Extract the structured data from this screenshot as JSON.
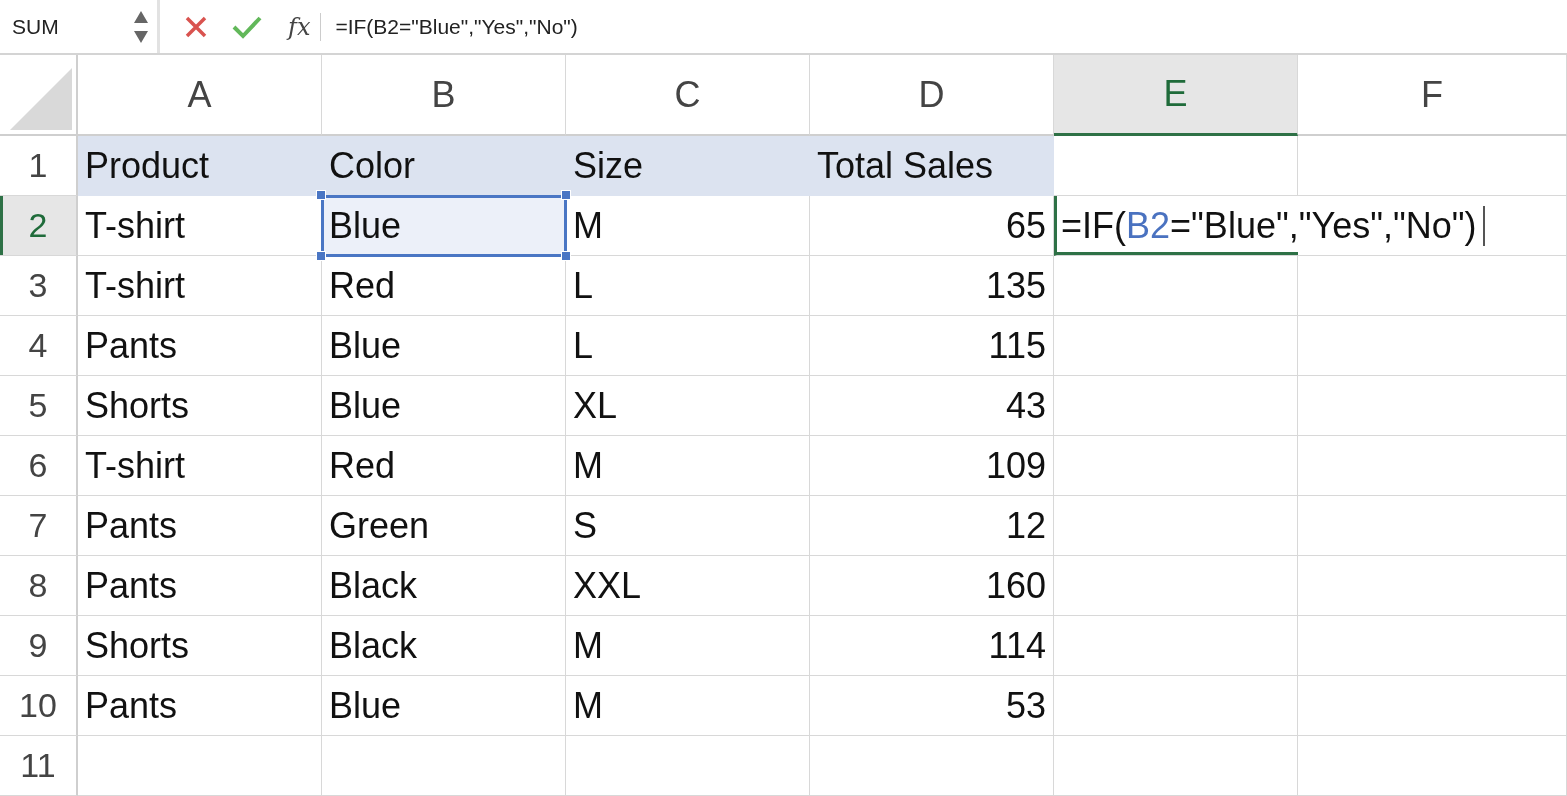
{
  "name_box": {
    "value": "SUM"
  },
  "formula_bar": {
    "function_label": "fx",
    "value": "=IF(B2=\"Blue\",\"Yes\",\"No\")"
  },
  "columns": [
    {
      "label": "A",
      "selected": false
    },
    {
      "label": "B",
      "selected": false
    },
    {
      "label": "C",
      "selected": false
    },
    {
      "label": "D",
      "selected": false
    },
    {
      "label": "E",
      "selected": true
    },
    {
      "label": "F",
      "selected": false
    }
  ],
  "rows": [
    {
      "number": "1",
      "selected": false,
      "cells": [
        {
          "kind": "header",
          "text": "Product",
          "selected": false
        },
        {
          "kind": "header",
          "text": "Color",
          "selected": false
        },
        {
          "kind": "header",
          "text": "Size",
          "selected": false
        },
        {
          "kind": "header",
          "text": "Total Sales",
          "selected": false
        }
      ]
    },
    {
      "number": "2",
      "selected": true,
      "cells": [
        {
          "kind": "text",
          "text": "T-shirt",
          "selected": false
        },
        {
          "kind": "text",
          "text": "Blue",
          "selected": true
        },
        {
          "kind": "text",
          "text": "M",
          "selected": false
        },
        {
          "kind": "number",
          "text": "65",
          "selected": false
        },
        {
          "kind": "editing",
          "selected": false,
          "parts": [
            {
              "kind": "plain",
              "text": "=IF("
            },
            {
              "kind": "ref",
              "text": "B2"
            },
            {
              "kind": "plain",
              "text": "=\"Blue\",\"Yes\",\"No\")"
            }
          ]
        }
      ]
    },
    {
      "number": "3",
      "selected": false,
      "cells": [
        {
          "kind": "text",
          "text": "T-shirt",
          "selected": false
        },
        {
          "kind": "text",
          "text": "Red",
          "selected": false
        },
        {
          "kind": "text",
          "text": "L",
          "selected": false
        },
        {
          "kind": "number",
          "text": "135",
          "selected": false
        }
      ]
    },
    {
      "number": "4",
      "selected": false,
      "cells": [
        {
          "kind": "text",
          "text": "Pants",
          "selected": false
        },
        {
          "kind": "text",
          "text": "Blue",
          "selected": false
        },
        {
          "kind": "text",
          "text": "L",
          "selected": false
        },
        {
          "kind": "number",
          "text": "115",
          "selected": false
        }
      ]
    },
    {
      "number": "5",
      "selected": false,
      "cells": [
        {
          "kind": "text",
          "text": "Shorts",
          "selected": false
        },
        {
          "kind": "text",
          "text": "Blue",
          "selected": false
        },
        {
          "kind": "text",
          "text": "XL",
          "selected": false
        },
        {
          "kind": "number",
          "text": "43",
          "selected": false
        }
      ]
    },
    {
      "number": "6",
      "selected": false,
      "cells": [
        {
          "kind": "text",
          "text": "T-shirt",
          "selected": false
        },
        {
          "kind": "text",
          "text": "Red",
          "selected": false
        },
        {
          "kind": "text",
          "text": "M",
          "selected": false
        },
        {
          "kind": "number",
          "text": "109",
          "selected": false
        }
      ]
    },
    {
      "number": "7",
      "selected": false,
      "cells": [
        {
          "kind": "text",
          "text": "Pants",
          "selected": false
        },
        {
          "kind": "text",
          "text": "Green",
          "selected": false
        },
        {
          "kind": "text",
          "text": "S",
          "selected": false
        },
        {
          "kind": "number",
          "text": "12",
          "selected": false
        }
      ]
    },
    {
      "number": "8",
      "selected": false,
      "cells": [
        {
          "kind": "text",
          "text": "Pants",
          "selected": false
        },
        {
          "kind": "text",
          "text": "Black",
          "selected": false
        },
        {
          "kind": "text",
          "text": "XXL",
          "selected": false
        },
        {
          "kind": "number",
          "text": "160",
          "selected": false
        }
      ]
    },
    {
      "number": "9",
      "selected": false,
      "cells": [
        {
          "kind": "text",
          "text": "Shorts",
          "selected": false
        },
        {
          "kind": "text",
          "text": "Black",
          "selected": false
        },
        {
          "kind": "text",
          "text": "M",
          "selected": false
        },
        {
          "kind": "number",
          "text": "114",
          "selected": false
        }
      ]
    },
    {
      "number": "10",
      "selected": false,
      "cells": [
        {
          "kind": "text",
          "text": "Pants",
          "selected": false
        },
        {
          "kind": "text",
          "text": "Blue",
          "selected": false
        },
        {
          "kind": "text",
          "text": "M",
          "selected": false
        },
        {
          "kind": "number",
          "text": "53",
          "selected": false
        }
      ]
    },
    {
      "number": "11",
      "selected": false
    }
  ]
}
